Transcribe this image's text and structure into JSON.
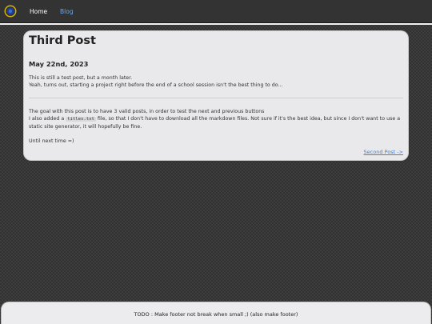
{
  "nav": {
    "logo": "site-logo",
    "home_label": "Home",
    "blog_label": "Blog"
  },
  "post": {
    "title": "Third Post",
    "date": "May 22nd, 2023",
    "p1": "This is still a test post, but a month later.",
    "p2": "Yeah, turns out, starting a project right before the end of a school session isn't the best thing to do...",
    "p3": "The goal with this post is to have 3 valid posts, in order to test the next and previous buttons",
    "p4_before": "I also added a ",
    "p4_code": "titles.txt",
    "p4_after": " file, so that I don't have to download all the markdown files. Not sure if it's the best idea, but since I don't want to use a static site generator, it will hopefully be fine.",
    "p5": "Until next time =)",
    "next_link": "Second Post ->"
  },
  "footer": {
    "text": "TODO : Make footer not break when small ;) (also make footer)"
  },
  "colors": {
    "background": "#3d3d3d",
    "navbar": "#333333",
    "card": "#e9e9ec",
    "link": "#3f7fd6",
    "active_nav": "#6aa8e8"
  }
}
